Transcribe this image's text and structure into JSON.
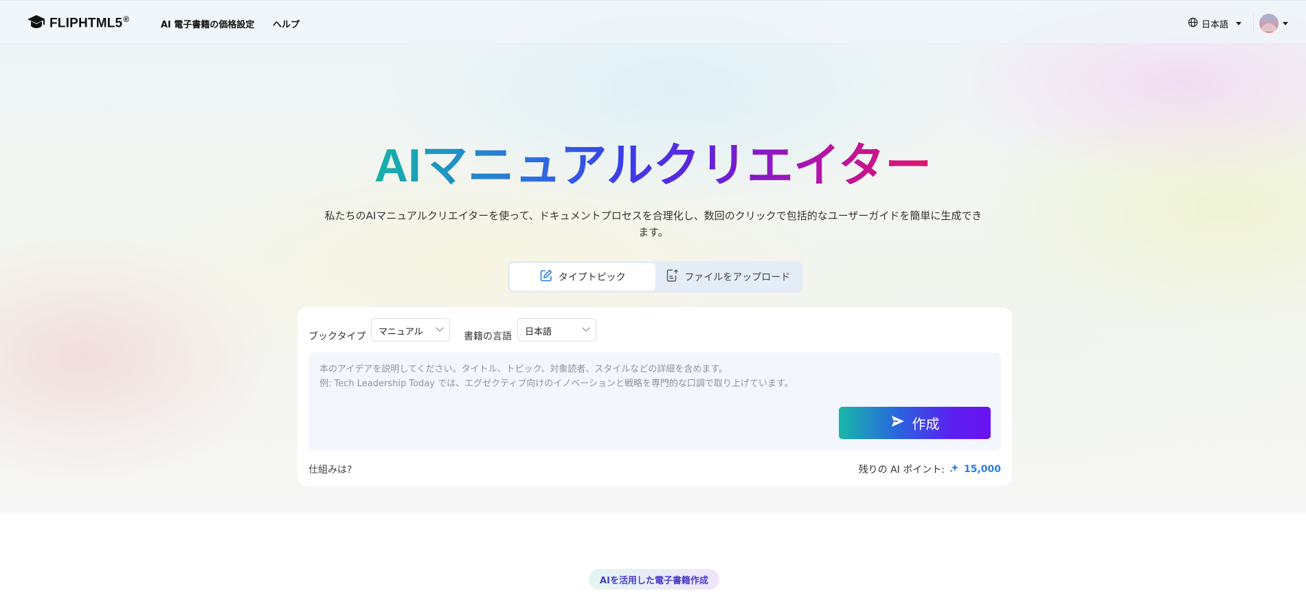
{
  "header": {
    "logo_text": "FLIPHTML5",
    "logo_mark": "®",
    "nav": [
      {
        "label": "AI 電子書籍の価格設定"
      },
      {
        "label": "ヘルプ"
      }
    ],
    "language": "日本語"
  },
  "hero": {
    "title": "AIマニュアルクリエイター",
    "subtitle": "私たちのAIマニュアルクリエイターを使って、ドキュメントプロセスを合理化し、数回のクリックで包括的なユーザーガイドを簡単に生成できます。"
  },
  "mode_tabs": [
    {
      "label": "タイプトピック",
      "icon": "edit-icon",
      "active": true
    },
    {
      "label": "ファイルをアップロード",
      "icon": "file-upload-icon",
      "active": false
    }
  ],
  "form": {
    "book_type_label": "ブックタイプ",
    "book_type_value": "マニュアル",
    "book_language_label": "書籍の言語",
    "book_language_value": "日本語",
    "placeholder_line1": "本のアイデアを説明してください。タイトル、トピック、対象読者、スタイルなどの詳細を含めます。",
    "placeholder_line2": "例: Tech Leadership Today では、エグゼクティブ向けのイノベーションと戦略を専門的な口調で取り上げています。",
    "create_label": "作成",
    "how_it_works": "仕組みは?",
    "points_label": "残りの AI ポイント:",
    "points_value": "15,000"
  },
  "section_badge": "AIを活用した電子書籍作成",
  "colors": {
    "accent_blue": "#2a7de8",
    "button_gradient_start": "#17b8a8",
    "button_gradient_end": "#6a12f0",
    "badge_text": "#4b3bc8"
  }
}
